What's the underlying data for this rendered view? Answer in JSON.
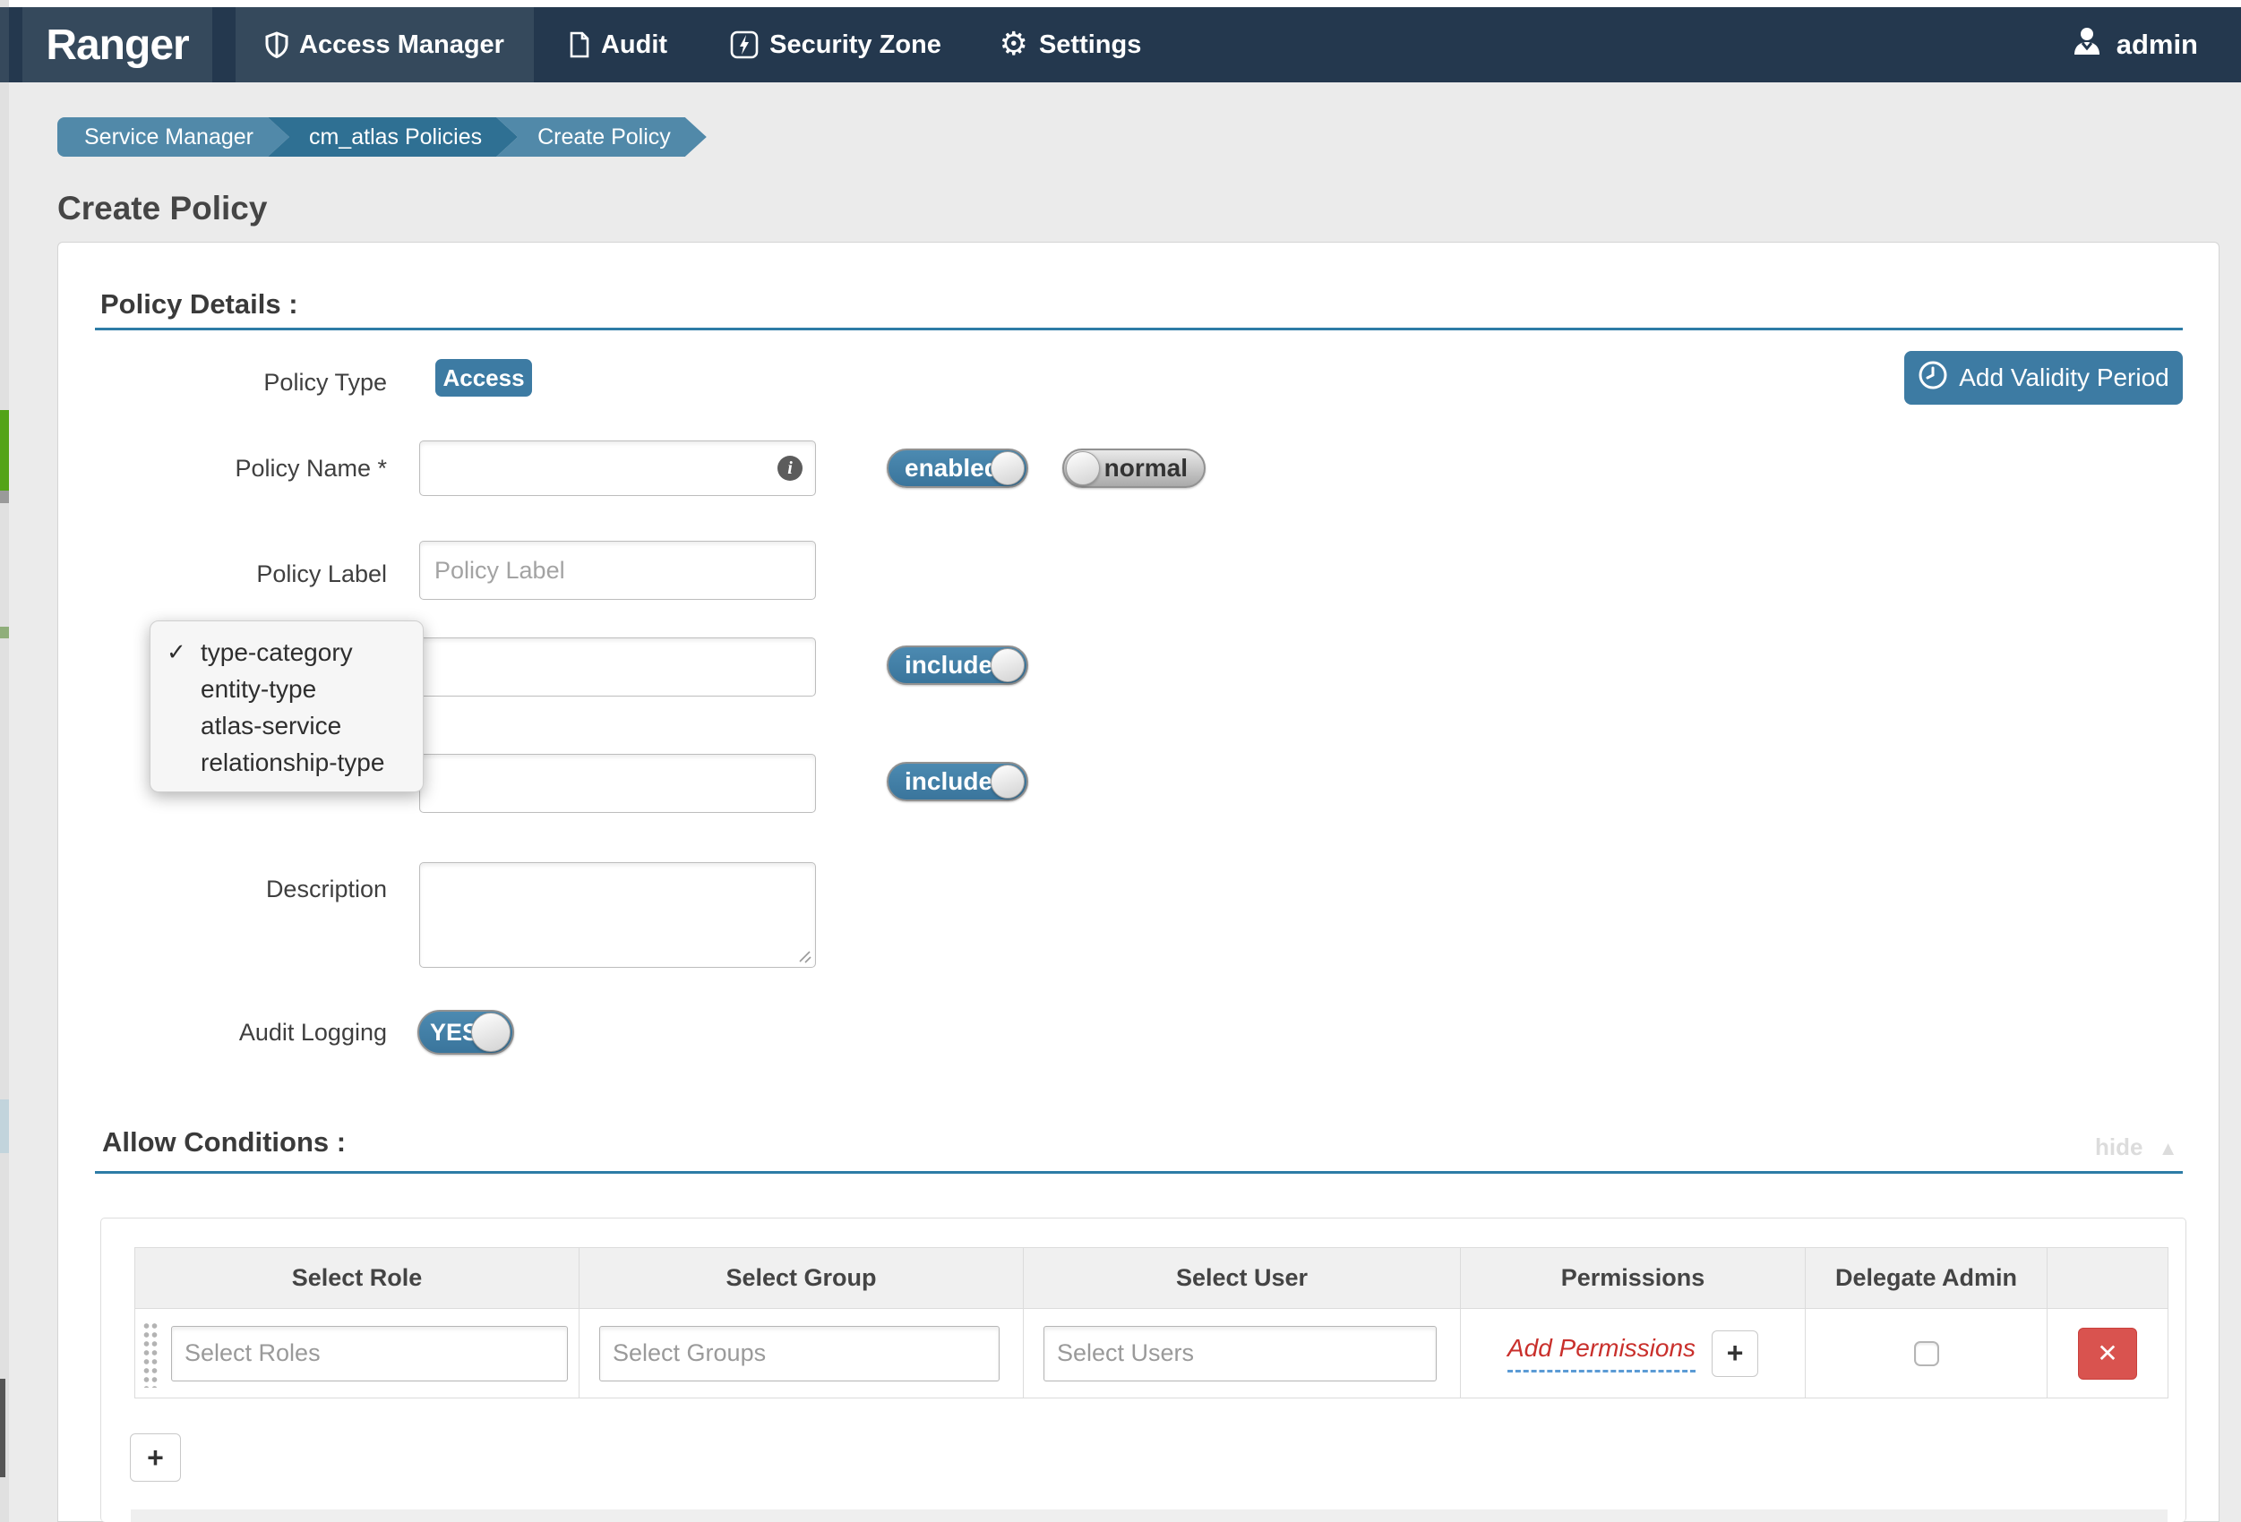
{
  "colors": {
    "navbar_bg": "#24384e",
    "navbar_active_bg": "#35495c",
    "accent_blue": "#3d7ba3",
    "breadcrumb_light": "#5189a9",
    "breadcrumb_dark": "#2f7093",
    "heading_rule_blue": "#2d7ca6",
    "danger_red": "#d9534f",
    "permission_link_red": "#c9302c"
  },
  "navbar": {
    "brand": "Ranger",
    "items": [
      {
        "label": "Access Manager",
        "icon": "shield-icon",
        "active": true
      },
      {
        "label": "Audit",
        "icon": "document-icon",
        "active": false
      },
      {
        "label": "Security Zone",
        "icon": "bolt-icon",
        "active": false
      },
      {
        "label": "Settings",
        "icon": "gear-icon",
        "active": false
      }
    ],
    "gear_glyph": "⚙",
    "user": "admin"
  },
  "breadcrumb": [
    "Service Manager",
    "cm_atlas Policies",
    "Create Policy"
  ],
  "page_title": "Create Policy",
  "policy_details": {
    "heading": "Policy Details :",
    "add_validity_label": "Add Validity Period",
    "policy_type_label": "Policy Type",
    "policy_type_value": "Access",
    "policy_name_label": "Policy Name *",
    "policy_name_value": "",
    "info_icon_glyph": "i",
    "enabled_toggle_label": "enabled",
    "status_toggle_label": "normal",
    "policy_label_label": "Policy Label",
    "policy_label_placeholder": "Policy Label",
    "include_toggle_label": "include",
    "description_label": "Description",
    "audit_logging_label": "Audit Logging",
    "audit_toggle_label": "YES"
  },
  "type_dropdown": {
    "checkmark": "✓",
    "options": [
      "type-category",
      "entity-type",
      "atlas-service",
      "relationship-type"
    ],
    "selected": "type-category"
  },
  "allow_conditions": {
    "heading": "Allow Conditions :",
    "hide_label": "hide",
    "collapse_glyph": "▲",
    "headers": [
      "Select Role",
      "Select Group",
      "Select User",
      "Permissions",
      "Delegate Admin"
    ],
    "row": {
      "roles_placeholder": "Select Roles",
      "groups_placeholder": "Select Groups",
      "users_placeholder": "Select Users",
      "permissions_link": "Add Permissions",
      "add_permission_button": "+",
      "delete_button": "✕"
    },
    "add_row_button": "+"
  }
}
